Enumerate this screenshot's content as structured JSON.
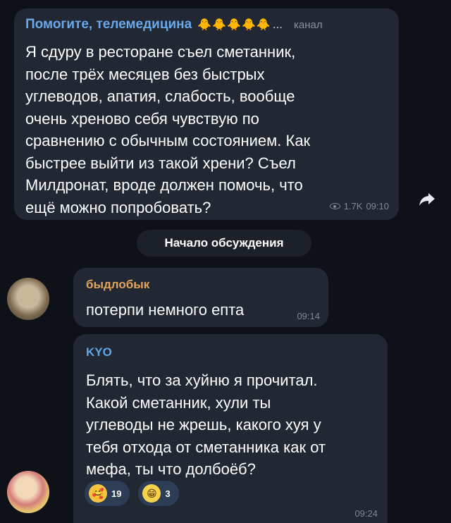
{
  "post": {
    "channel_name": "Помогите, телемедицина",
    "emoji": "🐥🐥🐥🐥🐥",
    "ellipsis": "...",
    "channel_label": "канал",
    "text": "Я сдуру в ресторане съел сметанник,\nпосле трёх месяцев без быстрых\nуглеводов, апатия, слабость, вообще\nочень хреново себя чувствую по\nсравнению с обычным состоянием. Как\nбыстрее выйти из такой хрени? Съел\nМилдронат, вроде должен помочь, что\nещё можно попробовать?",
    "views": "1.7K",
    "time": "09:10"
  },
  "share_icon": "share-arrow-icon",
  "discussion_label": "Начало обсуждения",
  "replies": [
    {
      "author": "быдлобык",
      "text": "потерпи немного епта",
      "time": "09:14"
    },
    {
      "author": "KYO",
      "text": "Блять, что за хуйню я прочитал.\nКакой сметанник, хули ты\nуглеводы не жрешь, какого хуя у\nтебя отхода от сметанника как от\nмефа, ты что долбоёб?",
      "time": "09:24",
      "reactions": [
        {
          "emoji": "🥰",
          "count": "19"
        },
        {
          "emoji": "😁",
          "count": "3"
        }
      ]
    }
  ],
  "colors": {
    "background": "#0e1117",
    "bubble": "#212833",
    "channel_name": "#6aa9e9",
    "author_1": "#e6a35a",
    "author_2": "#5fa8e8",
    "meta": "#7f8894"
  }
}
